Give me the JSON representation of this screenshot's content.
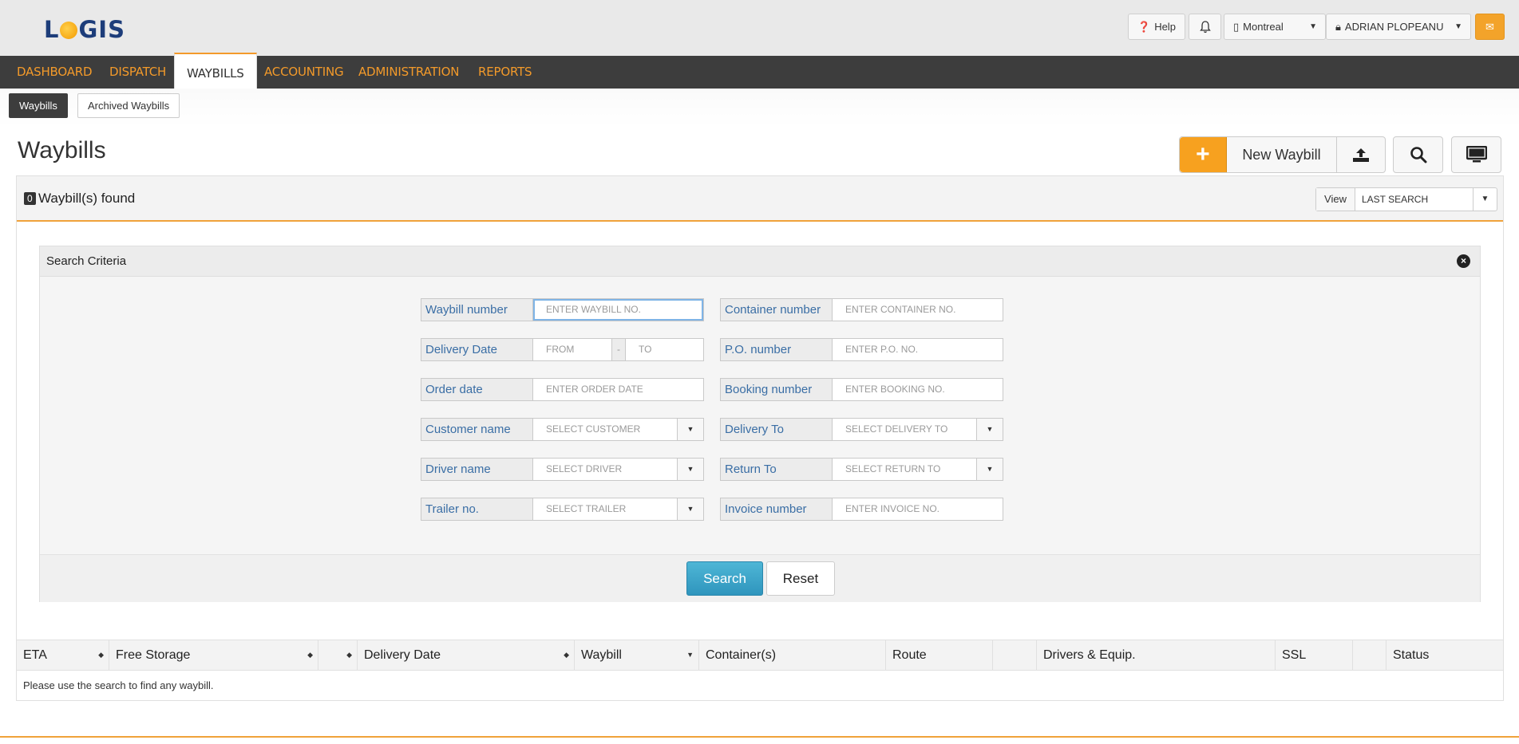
{
  "brand": {
    "logo_left": "L",
    "logo_right": "GIS",
    "accent": "#f39a2a",
    "nav_bg": "#3d3d3d"
  },
  "topbar": {
    "help_label": "Help",
    "location_label": "Montreal",
    "user_label": "ADRIAN PLOPEANU"
  },
  "mainnav": {
    "items": [
      {
        "label": "DASHBOARD"
      },
      {
        "label": "DISPATCH"
      },
      {
        "label": "WAYBILLS"
      },
      {
        "label": "ACCOUNTING"
      },
      {
        "label": "ADMINISTRATION"
      },
      {
        "label": "REPORTS"
      }
    ],
    "active": "WAYBILLS"
  },
  "subnav": {
    "tabs": [
      {
        "label": "Waybills"
      },
      {
        "label": "Archived Waybills"
      }
    ]
  },
  "page": {
    "title": "Waybills",
    "new_waybill_label": "New Waybill",
    "count": "0",
    "count_text": "Waybill(s) found",
    "view_label": "View",
    "view_value": "LAST SEARCH"
  },
  "search": {
    "title": "Search Criteria",
    "fields": {
      "waybill_number": {
        "label": "Waybill number",
        "placeholder": "ENTER WAYBILL NO."
      },
      "container_number": {
        "label": "Container number",
        "placeholder": "ENTER CONTAINER NO."
      },
      "delivery_date": {
        "label": "Delivery Date",
        "from": "FROM",
        "to": "TO",
        "sep": "-"
      },
      "po_number": {
        "label": "P.O. number",
        "placeholder": "ENTER P.O. NO."
      },
      "order_date": {
        "label": "Order date",
        "placeholder": "ENTER ORDER DATE"
      },
      "booking_number": {
        "label": "Booking number",
        "placeholder": "ENTER BOOKING NO."
      },
      "customer_name": {
        "label": "Customer name",
        "placeholder": "SELECT CUSTOMER"
      },
      "delivery_to": {
        "label": "Delivery To",
        "placeholder": "SELECT DELIVERY TO"
      },
      "driver_name": {
        "label": "Driver name",
        "placeholder": "SELECT DRIVER"
      },
      "return_to": {
        "label": "Return To",
        "placeholder": "SELECT RETURN TO"
      },
      "trailer_no": {
        "label": "Trailer no.",
        "placeholder": "SELECT TRAILER"
      },
      "invoice_number": {
        "label": "Invoice number",
        "placeholder": "ENTER INVOICE NO."
      }
    },
    "search_button": "Search",
    "reset_button": "Reset"
  },
  "grid": {
    "columns": [
      {
        "label": "ETA"
      },
      {
        "label": "Free Storage"
      },
      {
        "label": ""
      },
      {
        "label": "Delivery Date"
      },
      {
        "label": "Waybill"
      },
      {
        "label": "Container(s)"
      },
      {
        "label": "Route"
      },
      {
        "label": ""
      },
      {
        "label": "Drivers & Equip."
      },
      {
        "label": "SSL"
      },
      {
        "label": ""
      },
      {
        "label": "Status"
      }
    ],
    "empty_message": "Please use the search to find any waybill."
  }
}
